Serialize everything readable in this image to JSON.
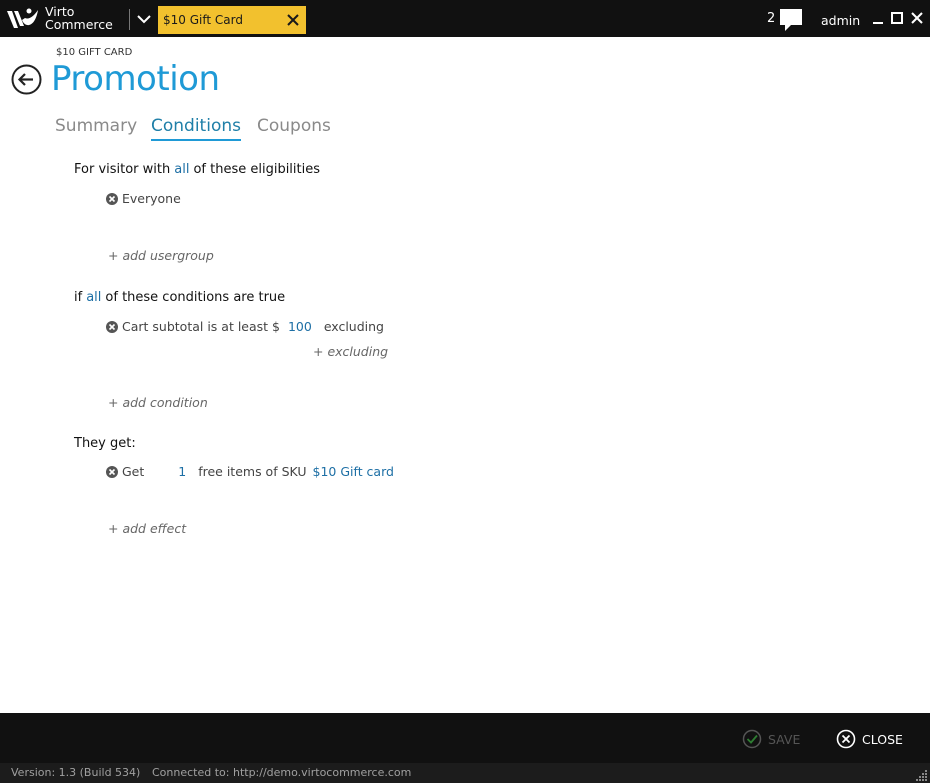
{
  "app": {
    "brand_line1": "Virto",
    "brand_line2": "Commerce",
    "open_tab_label": "$10 Gift Card",
    "notification_count": "2",
    "user_name": "admin"
  },
  "header": {
    "breadcrumb": "$10 GIFT CARD",
    "title": "Promotion",
    "tabs": [
      {
        "label": "Summary"
      },
      {
        "label": "Conditions"
      },
      {
        "label": "Coupons"
      }
    ]
  },
  "eligibility": {
    "prefix": "For visitor with",
    "mode": "all",
    "suffix": "of these eligibilities",
    "items": [
      {
        "label": "Everyone"
      }
    ],
    "add_label": "+ add usergroup"
  },
  "conditions": {
    "prefix": "if",
    "mode": "all",
    "suffix": "of these conditions are true",
    "items": [
      {
        "label": "Cart subtotal is at least $",
        "value": "100",
        "after": "excluding",
        "sub_add": "+ excluding"
      }
    ],
    "add_label": "+ add condition"
  },
  "effects": {
    "heading": "They get:",
    "items": [
      {
        "label": "Get",
        "quantity": "1",
        "middle": "free items of SKU",
        "sku": "$10 Gift card"
      }
    ],
    "add_label": "+ add effect"
  },
  "footer": {
    "save_label": "SAVE",
    "close_label": "CLOSE"
  },
  "status": {
    "version": "Version: 1.3 (Build 534)",
    "connection": "Connected to: http://demo.virtocommerce.com"
  },
  "colors": {
    "accent": "#1f9ad6",
    "tab_yellow": "#f2c12e",
    "bar_dark": "#111111",
    "link_blue": "#1d6fa5"
  },
  "icons": [
    "virto-logo-icon",
    "chevron-down-icon",
    "close-icon",
    "chat-bubble-icon",
    "minimize-icon",
    "maximize-icon",
    "back-arrow-icon",
    "remove-circle-icon",
    "checkmark-icon",
    "close-circle-icon",
    "resize-grip-icon"
  ]
}
